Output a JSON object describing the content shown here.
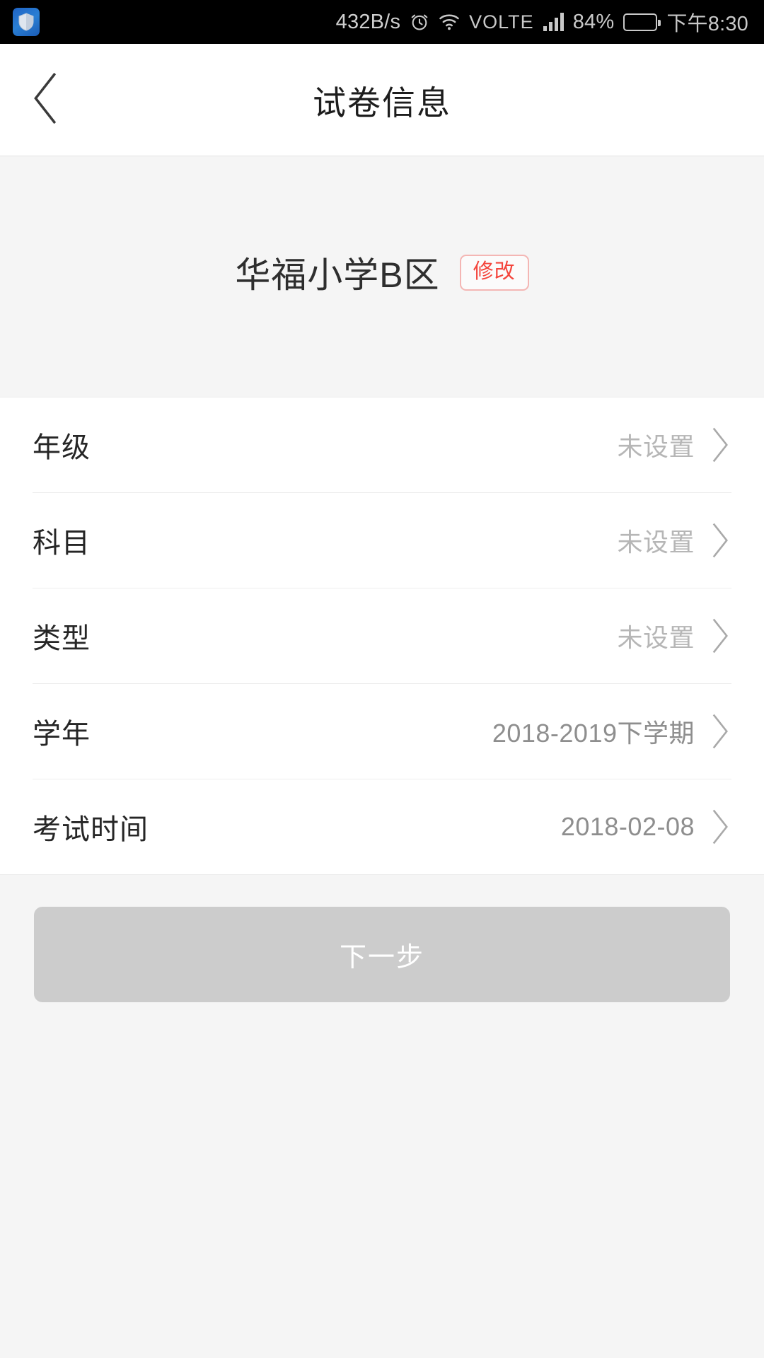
{
  "status_bar": {
    "app_badge_icon": "shield-icon",
    "network_speed": "432B/s",
    "alarm_icon": "alarm-clock-icon",
    "wifi_icon": "wifi-icon",
    "volte_label": "VOLTE",
    "signal_icon": "signal-bars-icon",
    "battery_percent": "84%",
    "battery_icon": "battery-icon",
    "battery_level": 84,
    "clock": "下午8:30"
  },
  "nav": {
    "back_icon": "chevron-left-icon",
    "title": "试卷信息"
  },
  "school": {
    "name": "华福小学B区",
    "modify_label": "修改",
    "modify_color": "#f4453c",
    "modify_border_color": "#f4b6b4"
  },
  "list": {
    "chevron_icon": "chevron-right-icon",
    "rows": [
      {
        "label": "年级",
        "value": "未设置",
        "is_set": false
      },
      {
        "label": "科目",
        "value": "未设置",
        "is_set": false
      },
      {
        "label": "类型",
        "value": "未设置",
        "is_set": false
      },
      {
        "label": "学年",
        "value": "2018-2019下学期",
        "is_set": true
      },
      {
        "label": "考试时间",
        "value": "2018-02-08",
        "is_set": true
      }
    ]
  },
  "footer": {
    "next_label": "下一步",
    "next_enabled": false,
    "next_bg": "#cccccc"
  }
}
